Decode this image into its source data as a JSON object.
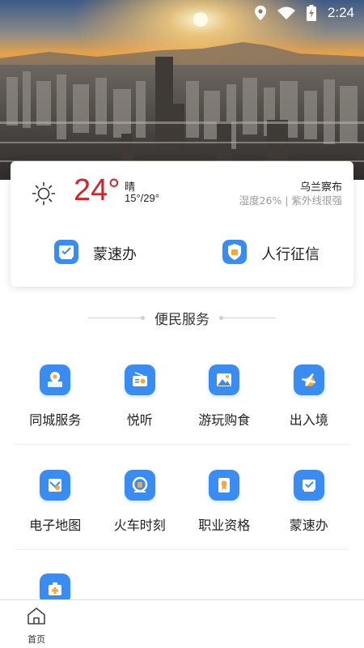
{
  "status_bar": {
    "time": "2:24",
    "icons": [
      "location-icon",
      "wifi-icon",
      "battery-charging-icon"
    ]
  },
  "weather": {
    "icon": "sun-icon",
    "temperature": "24°",
    "condition": "晴",
    "range": "15°/29°",
    "city": "乌兰察布",
    "details": "湿度26% | 紫外线很强"
  },
  "quick_actions": [
    {
      "label": "蒙速办",
      "icon": "mengsuban-icon"
    },
    {
      "label": "人行征信",
      "icon": "credit-shield-icon"
    }
  ],
  "section": {
    "title": "便民服务"
  },
  "services": [
    {
      "label": "同城服务",
      "icon": "map-pin-icon"
    },
    {
      "label": "悦听",
      "icon": "radio-icon"
    },
    {
      "label": "游玩购食",
      "icon": "landscape-icon"
    },
    {
      "label": "出入境",
      "icon": "airplane-globe-icon"
    },
    {
      "label": "电子地图",
      "icon": "map-icon"
    },
    {
      "label": "火车时刻",
      "icon": "train-icon"
    },
    {
      "label": "职业资格",
      "icon": "certificate-icon"
    },
    {
      "label": "蒙速办",
      "icon": "mengsuban-icon"
    },
    {
      "label": "",
      "icon": "medical-kit-icon"
    }
  ],
  "bottom_nav": {
    "home_label": "首页",
    "home_icon": "home-icon"
  },
  "colors": {
    "temperature": "#d0262b",
    "icon_blue": "#3a8cf0"
  }
}
